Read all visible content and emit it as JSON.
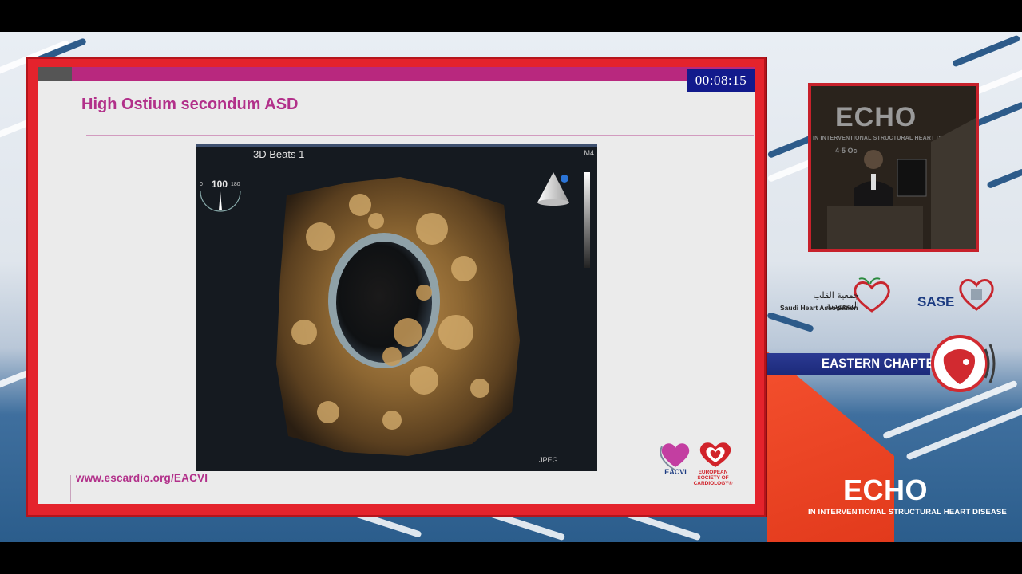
{
  "slide": {
    "timer": "00:08:15",
    "title": "High Ostium secondum ASD",
    "url": "www.escardio.org/EACVI",
    "echo": {
      "label": "3D Beats 1",
      "mode": "M4",
      "format": "JPEG",
      "angle": "100",
      "angle_min": "0",
      "angle_max": "180"
    },
    "logos": {
      "eacvi": "EACVI",
      "esc_line1": "EUROPEAN",
      "esc_line2": "SOCIETY OF",
      "esc_line3": "CARDIOLOGY®"
    }
  },
  "camera": {
    "backdrop_title": "ECHO",
    "backdrop_sub": "IN INTERVENTIONAL STRUCTURAL HEART DISEASE",
    "backdrop_date": "4-5 Oc"
  },
  "sponsors": {
    "sha_arabic": "جمعية القلب السعودية",
    "sha_english": "Saudi Heart Association",
    "sase": "SASE"
  },
  "chapter": {
    "label": "EASTERN CHAPTER"
  },
  "brand": {
    "title": "ECHO",
    "subtitle": "IN INTERVENTIONAL STRUCTURAL HEART DISEASE"
  },
  "colors": {
    "accent_magenta": "#b2308a",
    "frame_red": "#e4232c",
    "timer_blue": "#121a8c",
    "chapter_blue": "#2b3a93"
  }
}
